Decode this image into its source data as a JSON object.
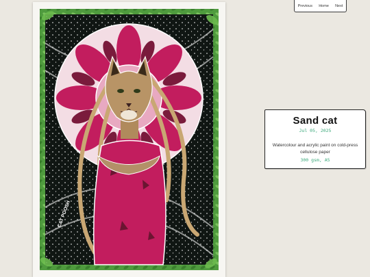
{
  "nav": {
    "previous": "Previous",
    "home": "Home",
    "next": "Next"
  },
  "artwork": {
    "signature": "CAT POOSH"
  },
  "card": {
    "title": "Sand cat",
    "date": "Jul 05, 2025",
    "description": "Watercolour and acrylic paint on cold-press cellulose paper",
    "specs": "300 gsm, A5"
  },
  "colors": {
    "background": "#ebe8e1",
    "accent_green": "#3aa87a",
    "leaf_green": "#5fa84a",
    "magenta": "#c21d5e"
  }
}
